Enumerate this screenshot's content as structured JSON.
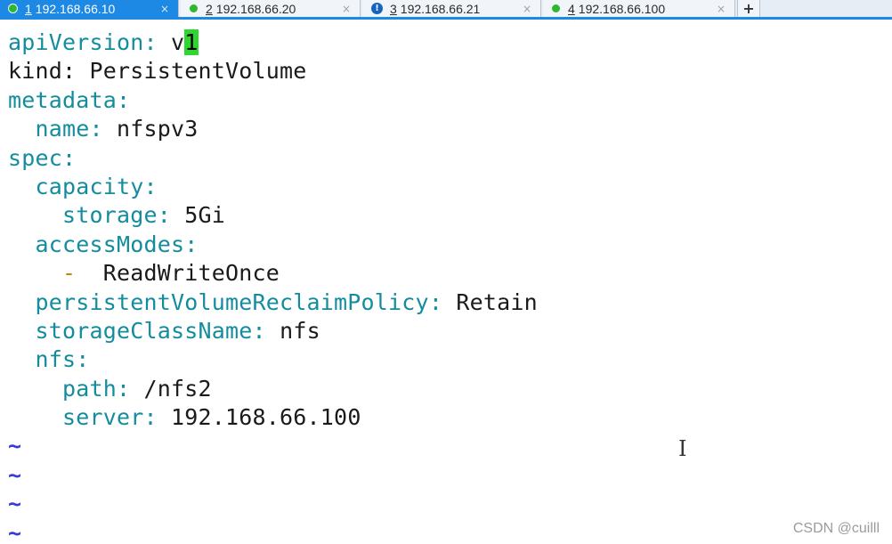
{
  "tabs": [
    {
      "number": "1",
      "host": "192.168.66.10",
      "status": "connected",
      "active": true,
      "close": "×"
    },
    {
      "number": "2",
      "host": "192.168.66.20",
      "status": "connected",
      "active": false,
      "close": "×"
    },
    {
      "number": "3",
      "host": "192.168.66.21",
      "status": "info",
      "active": false,
      "close": "×"
    },
    {
      "number": "4",
      "host": "192.168.66.100",
      "status": "connected",
      "active": false,
      "close": "×"
    }
  ],
  "tab_add_label": "+",
  "status_icons": {
    "connected": "green-dot-icon",
    "info": "info-icon"
  },
  "colors": {
    "tab_active": "#1e88e5",
    "yaml_key": "#138d9e",
    "cursor": "#2fd62f",
    "tilde": "#3a3ad6"
  },
  "editor": {
    "lines": [
      {
        "indent": "",
        "key": "apiVersion",
        "sep": ": ",
        "value_before_cursor": "v",
        "cursor_char": "1",
        "value": ""
      },
      {
        "indent": "",
        "key": "kind",
        "sep": ": ",
        "value": "PersistentVolume"
      },
      {
        "indent": "",
        "key": "metadata",
        "sep": ":",
        "value": ""
      },
      {
        "indent": "  ",
        "key": "name",
        "sep": ": ",
        "value": "nfspv3"
      },
      {
        "indent": "",
        "key": "spec",
        "sep": ":",
        "value": ""
      },
      {
        "indent": "  ",
        "key": "capacity",
        "sep": ":",
        "value": ""
      },
      {
        "indent": "    ",
        "key": "storage",
        "sep": ": ",
        "value": "5Gi"
      },
      {
        "indent": "  ",
        "key": "accessModes",
        "sep": ":",
        "value": ""
      },
      {
        "indent": "    ",
        "dash": "-",
        "value": "  ReadWriteOnce"
      },
      {
        "indent": "  ",
        "key": "persistentVolumeReclaimPolicy",
        "sep": ": ",
        "value": "Retain"
      },
      {
        "indent": "  ",
        "key": "storageClassName",
        "sep": ": ",
        "value": "nfs"
      },
      {
        "indent": "  ",
        "key": "nfs",
        "sep": ":",
        "value": ""
      },
      {
        "indent": "    ",
        "key": "path",
        "sep": ": ",
        "value": "/nfs2"
      },
      {
        "indent": "    ",
        "key": "server",
        "sep": ": ",
        "value": "192.168.66.100"
      }
    ],
    "tildes": [
      "~",
      "~",
      "~",
      "~"
    ]
  },
  "mouse_cursor": "I",
  "watermark": "CSDN @cuilll"
}
